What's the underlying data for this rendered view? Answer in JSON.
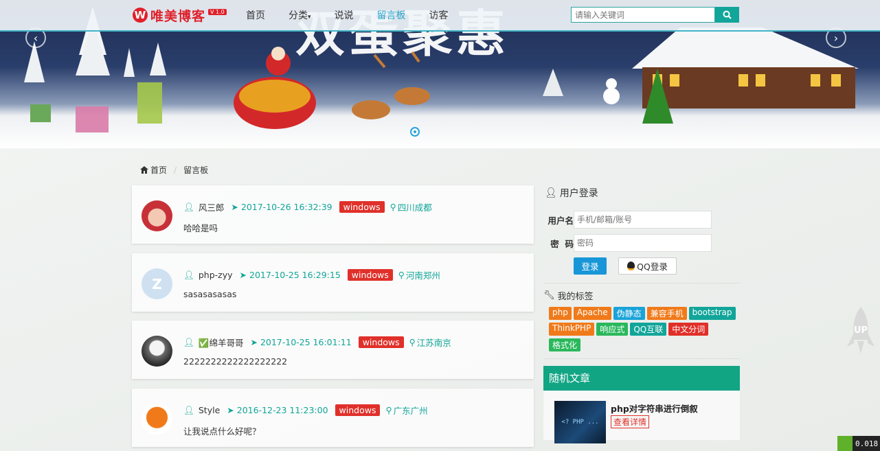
{
  "header": {
    "logo_mark": "W",
    "logo_text": "唯美博客",
    "logo_version": "V 1.0",
    "nav": [
      {
        "label": "首页",
        "active": false
      },
      {
        "label": "分类",
        "active": false
      },
      {
        "label": "说说",
        "active": false
      },
      {
        "label": "留言板",
        "active": true
      },
      {
        "label": "访客",
        "active": false
      }
    ],
    "search_placeholder": "请输入关键词"
  },
  "banner": {
    "title": "双蛋聚惠"
  },
  "breadcrumb": {
    "home": "首页",
    "current": "留言板"
  },
  "comments": [
    {
      "user": "风三郎",
      "time": "2017-10-26 16:32:39",
      "os": "windows",
      "location": "四川成都",
      "text": "哈哈是吗"
    },
    {
      "user": "php-zyy",
      "time": "2017-10-25 16:29:15",
      "os": "windows",
      "location": "河南郑州",
      "text": "sasasasasas"
    },
    {
      "user": "✅绵羊哥哥",
      "time": "2017-10-25 16:01:11",
      "os": "windows",
      "location": "江苏南京",
      "text": "2222222222222222222"
    },
    {
      "user": "Style",
      "time": "2016-12-23 11:23:00",
      "os": "windows",
      "location": "广东广州",
      "text": "让我说点什么好呢？"
    }
  ],
  "login": {
    "title": "用户登录",
    "username_label": "用户名",
    "username_placeholder": "手机/邮箱/账号",
    "password_label": "密  码",
    "password_placeholder": "密码",
    "login_button": "登录",
    "qq_button": "QQ登录"
  },
  "tags": {
    "title": "我的标签",
    "items": [
      {
        "label": "php",
        "color": "#f07a1a"
      },
      {
        "label": "Apache",
        "color": "#f07a1a"
      },
      {
        "label": "伪静态",
        "color": "#1aa3d8"
      },
      {
        "label": "兼容手机",
        "color": "#f07a1a"
      },
      {
        "label": "bootstrap",
        "color": "#12a59a"
      },
      {
        "label": "ThinkPHP",
        "color": "#f07a1a"
      },
      {
        "label": "响应式",
        "color": "#2ab85c"
      },
      {
        "label": "QQ互联",
        "color": "#12a59a"
      },
      {
        "label": "中文分词",
        "color": "#e0302a"
      },
      {
        "label": "格式化",
        "color": "#2ab85c"
      }
    ]
  },
  "random": {
    "title": "随机文章",
    "item_title": "php对字符串进行倒叙",
    "item_more": "查看详情",
    "thumb_text": "<? PHP ..."
  },
  "misc": {
    "up_label": "UP",
    "perf_value": "0.018"
  }
}
